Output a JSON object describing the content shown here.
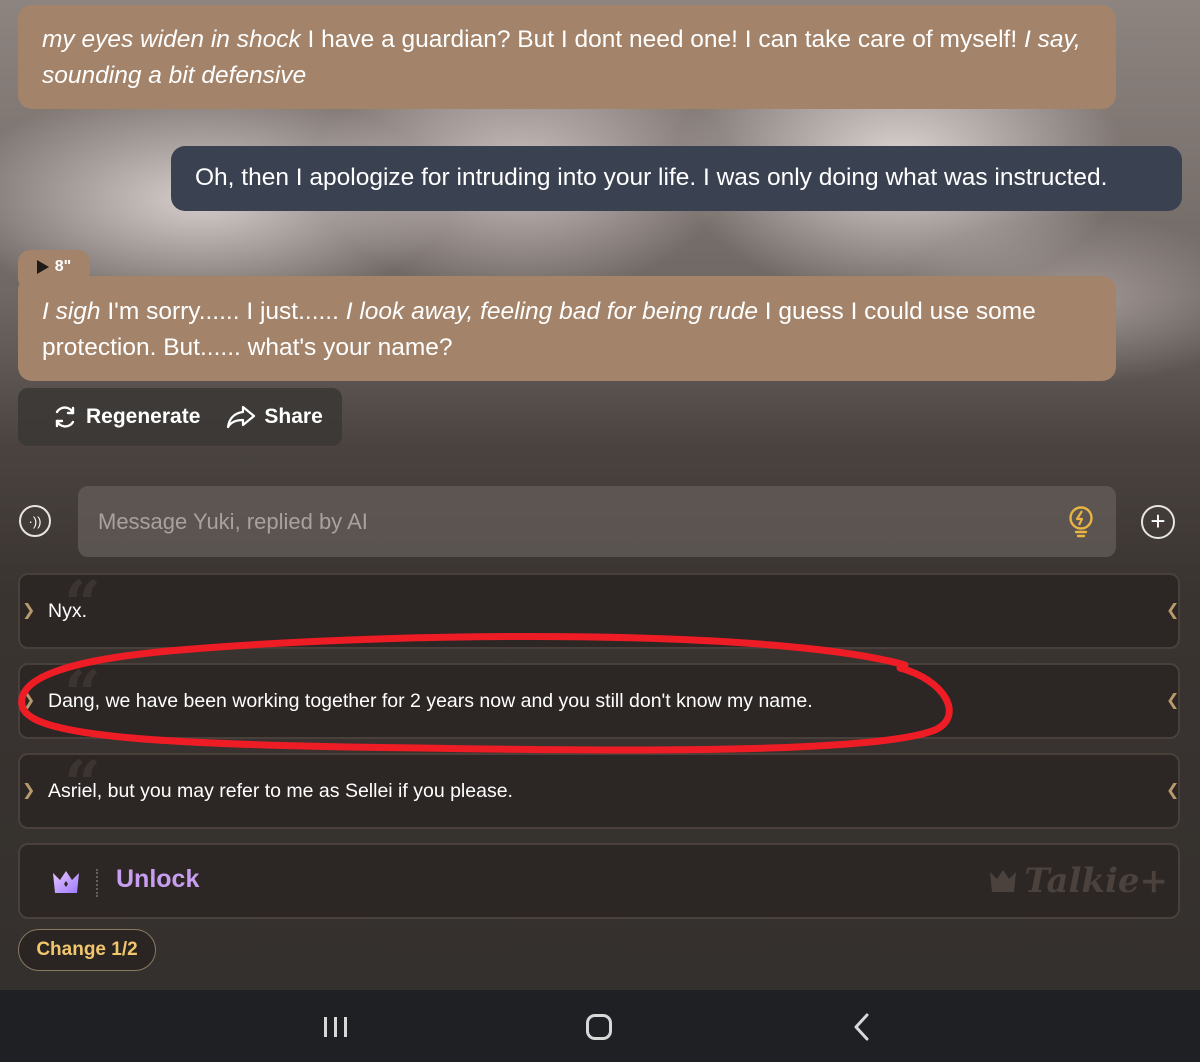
{
  "chat": {
    "ai_message_1": {
      "part1_italic": "my eyes widen in shock",
      "part2": " I have a guardian? But I dont need one! I can take care of myself! ",
      "part3_italic": "I say, sounding a bit defensive"
    },
    "user_message": "Oh, then I apologize for intruding into your life. I was only doing what was instructed.",
    "voice_duration": "8\"",
    "ai_message_2": {
      "part1_italic": "I sigh",
      "part2": " I'm sorry...... I just...... ",
      "part3_italic": "I look away, feeling bad for being rude",
      "part4": " I guess I could use some protection. But...... what's your name?"
    }
  },
  "actions": {
    "regenerate_label": "Regenerate",
    "share_label": "Share"
  },
  "composer": {
    "placeholder": "Message Yuki, replied by AI"
  },
  "suggestions": [
    "Nyx.",
    "Dang, we have been working together for 2 years now and you still don't know my name.",
    "Asriel, but you may refer to me as Sellei if you please."
  ],
  "unlock": {
    "label": "Unlock",
    "brand": "Talkie+"
  },
  "change_button": "Change 1/2",
  "colors": {
    "ai_bubble": "#a3846a",
    "user_bubble": "#3a4150",
    "unlock_accent": "#c89ef0",
    "change_text": "#f1c66d",
    "annotation_red": "#ee1c24"
  }
}
